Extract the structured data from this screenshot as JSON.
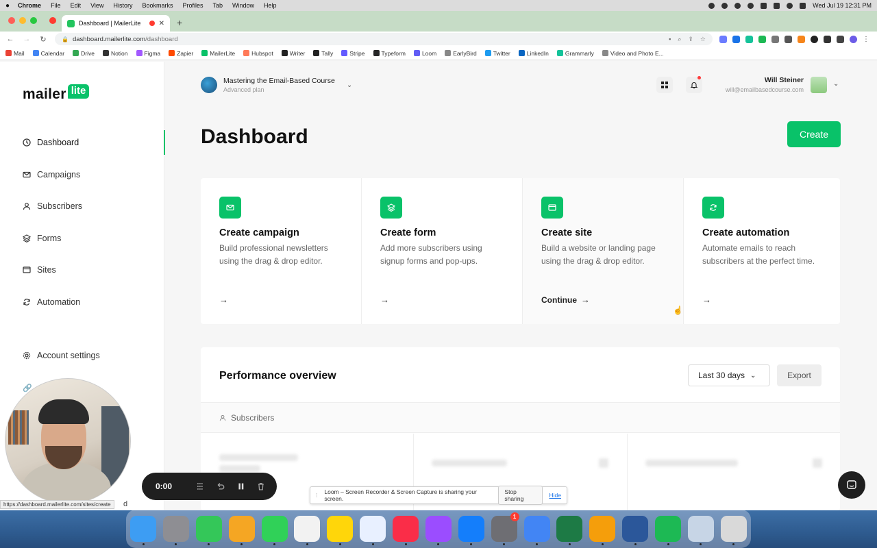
{
  "menubar": {
    "app": "Chrome",
    "items": [
      "File",
      "Edit",
      "View",
      "History",
      "Bookmarks",
      "Profiles",
      "Tab",
      "Window",
      "Help"
    ],
    "datetime": "Wed Jul 19  12:31 PM"
  },
  "browser": {
    "tab_title": "Dashboard | MailerLite",
    "url_host": "dashboard.mailerlite.com",
    "url_path": "/dashboard",
    "bookmarks": [
      {
        "label": "Mail",
        "color": "#ea4335"
      },
      {
        "label": "Calendar",
        "color": "#4285f4"
      },
      {
        "label": "Drive",
        "color": "#34a853"
      },
      {
        "label": "Notion",
        "color": "#333333"
      },
      {
        "label": "Figma",
        "color": "#a259ff"
      },
      {
        "label": "Zapier",
        "color": "#ff4a00"
      },
      {
        "label": "MailerLite",
        "color": "#09c269"
      },
      {
        "label": "Hubspot",
        "color": "#ff7a59"
      },
      {
        "label": "Writer",
        "color": "#222222"
      },
      {
        "label": "Tally",
        "color": "#222222"
      },
      {
        "label": "Stripe",
        "color": "#635bff"
      },
      {
        "label": "Typeform",
        "color": "#262627"
      },
      {
        "label": "Loom",
        "color": "#625df5"
      },
      {
        "label": "EarlyBird",
        "color": "#888888"
      },
      {
        "label": "Twitter",
        "color": "#1d9bf0"
      },
      {
        "label": "LinkedIn",
        "color": "#0a66c2"
      },
      {
        "label": "Grammarly",
        "color": "#15c39a"
      },
      {
        "label": "Video and Photo E...",
        "color": "#888888"
      }
    ]
  },
  "sidebar": {
    "logo_word": "mailer",
    "logo_badge": "lite",
    "items": [
      {
        "label": "Dashboard",
        "icon": "dashboard-icon"
      },
      {
        "label": "Campaigns",
        "icon": "mail-icon"
      },
      {
        "label": "Subscribers",
        "icon": "user-icon"
      },
      {
        "label": "Forms",
        "icon": "layers-icon"
      },
      {
        "label": "Sites",
        "icon": "browser-icon"
      },
      {
        "label": "Automation",
        "icon": "refresh-icon"
      }
    ],
    "account_settings": "Account settings",
    "partial_item_tail": "d"
  },
  "header": {
    "account_name": "Mastering the Email-Based Course",
    "account_plan": "Advanced plan",
    "user_name": "Will Steiner",
    "user_email": "will@emailbasedcourse.com"
  },
  "main": {
    "title": "Dashboard",
    "create_label": "Create",
    "cards": [
      {
        "title": "Create campaign",
        "desc": "Build professional newsletters using the drag & drop editor.",
        "action": "",
        "icon": "mail-icon"
      },
      {
        "title": "Create form",
        "desc": "Add more subscribers using signup forms and pop-ups.",
        "action": "",
        "icon": "layers-icon"
      },
      {
        "title": "Create site",
        "desc": "Build a website or landing page using the drag & drop editor.",
        "action": "Continue",
        "icon": "browser-icon"
      },
      {
        "title": "Create automation",
        "desc": "Automate emails to reach subscribers at the perfect time.",
        "action": "",
        "icon": "refresh-icon"
      }
    ],
    "performance": {
      "title": "Performance overview",
      "range": "Last 30 days",
      "export": "Export",
      "tab": "Subscribers"
    }
  },
  "overlay": {
    "timer": "0:00",
    "status_url": "https://dashboard.mailerlite.com/sites/create",
    "loom_message": "Loom – Screen Recorder & Screen Capture is sharing your screen.",
    "stop_sharing": "Stop sharing",
    "hide": "Hide"
  },
  "dock": {
    "apps": [
      {
        "name": "finder-icon",
        "color": "#3d9df3"
      },
      {
        "name": "launchpad-icon",
        "color": "#8e8e93"
      },
      {
        "name": "messages-icon",
        "color": "#34c759"
      },
      {
        "name": "photos-icon",
        "color": "#f5a623"
      },
      {
        "name": "facetime-icon",
        "color": "#30d158"
      },
      {
        "name": "reminders-icon",
        "color": "#f2f2f2"
      },
      {
        "name": "notes-icon",
        "color": "#ffd60a"
      },
      {
        "name": "freeform-icon",
        "color": "#e8f0ff"
      },
      {
        "name": "music-icon",
        "color": "#fa2d48"
      },
      {
        "name": "podcasts-icon",
        "color": "#9b4dff"
      },
      {
        "name": "appstore-icon",
        "color": "#147efb"
      },
      {
        "name": "settings-icon",
        "color": "#6e6e73",
        "badge": "1"
      },
      {
        "name": "chrome-icon",
        "color": "#4285f4"
      },
      {
        "name": "excel-icon",
        "color": "#1d7a45"
      },
      {
        "name": "vpn-icon",
        "color": "#f59e0b"
      },
      {
        "name": "word-icon",
        "color": "#2b579a"
      },
      {
        "name": "spotify-icon",
        "color": "#1db954"
      },
      {
        "name": "preview-icon",
        "color": "#c7d5e6"
      },
      {
        "name": "trash-icon",
        "color": "#d9d9d9"
      }
    ]
  }
}
